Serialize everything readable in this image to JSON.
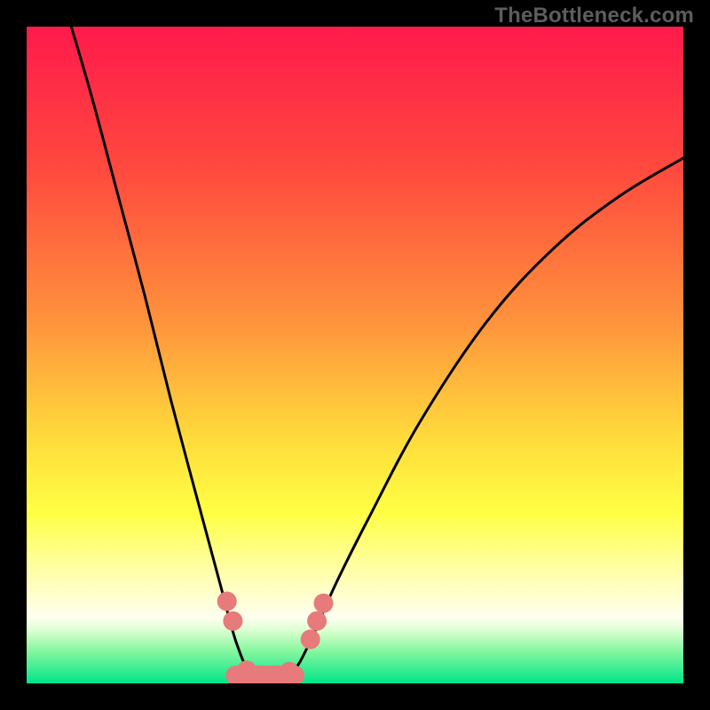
{
  "watermark": "TheBottleneck.com",
  "chart_data": {
    "type": "line",
    "title": "",
    "xlabel": "",
    "ylabel": "",
    "xlim": [
      0,
      740
    ],
    "ylim": [
      0,
      740
    ],
    "grid": false,
    "legend_position": "none",
    "gradient_stops": [
      {
        "offset": 0.0,
        "color": "#ff1a4b"
      },
      {
        "offset": 0.22,
        "color": "#ff4a3e"
      },
      {
        "offset": 0.45,
        "color": "#ff933c"
      },
      {
        "offset": 0.62,
        "color": "#ffd93b"
      },
      {
        "offset": 0.74,
        "color": "#ffff44"
      },
      {
        "offset": 0.82,
        "color": "#ffffa0"
      },
      {
        "offset": 0.9,
        "color": "#fffff0"
      },
      {
        "offset": 0.92,
        "color": "#d9ffcf"
      },
      {
        "offset": 0.95,
        "color": "#87f7a0"
      },
      {
        "offset": 1.0,
        "color": "#00e58a"
      }
    ],
    "series": [
      {
        "name": "bottleneck-curve",
        "description": "V-shaped bottleneck curve; minimum near x≈0.365",
        "stroke": "#000000",
        "stroke_width": 3,
        "points": [
          {
            "x": 0.068,
            "y": 1.0
          },
          {
            "x": 0.1,
            "y": 0.89
          },
          {
            "x": 0.14,
            "y": 0.74
          },
          {
            "x": 0.18,
            "y": 0.59
          },
          {
            "x": 0.22,
            "y": 0.43
          },
          {
            "x": 0.26,
            "y": 0.28
          },
          {
            "x": 0.295,
            "y": 0.15
          },
          {
            "x": 0.32,
            "y": 0.06
          },
          {
            "x": 0.343,
            "y": 0.015
          },
          {
            "x": 0.378,
            "y": 0.01
          },
          {
            "x": 0.405,
            "y": 0.018
          },
          {
            "x": 0.43,
            "y": 0.06
          },
          {
            "x": 0.47,
            "y": 0.15
          },
          {
            "x": 0.52,
            "y": 0.25
          },
          {
            "x": 0.6,
            "y": 0.4
          },
          {
            "x": 0.7,
            "y": 0.55
          },
          {
            "x": 0.8,
            "y": 0.66
          },
          {
            "x": 0.9,
            "y": 0.74
          },
          {
            "x": 1.0,
            "y": 0.8
          }
        ]
      }
    ],
    "markers": {
      "color": "#e77a7a",
      "radius": 11,
      "points": [
        {
          "x": 0.305,
          "y": 0.125
        },
        {
          "x": 0.314,
          "y": 0.095
        },
        {
          "x": 0.335,
          "y": 0.02
        },
        {
          "x": 0.355,
          "y": 0.012
        },
        {
          "x": 0.38,
          "y": 0.012
        },
        {
          "x": 0.4,
          "y": 0.018
        },
        {
          "x": 0.432,
          "y": 0.067
        },
        {
          "x": 0.442,
          "y": 0.095
        },
        {
          "x": 0.452,
          "y": 0.122
        }
      ]
    },
    "bar_segment": {
      "x_start": 0.318,
      "x_end": 0.408,
      "y": 0.012,
      "thickness": 22,
      "color": "#e77a7a"
    }
  }
}
